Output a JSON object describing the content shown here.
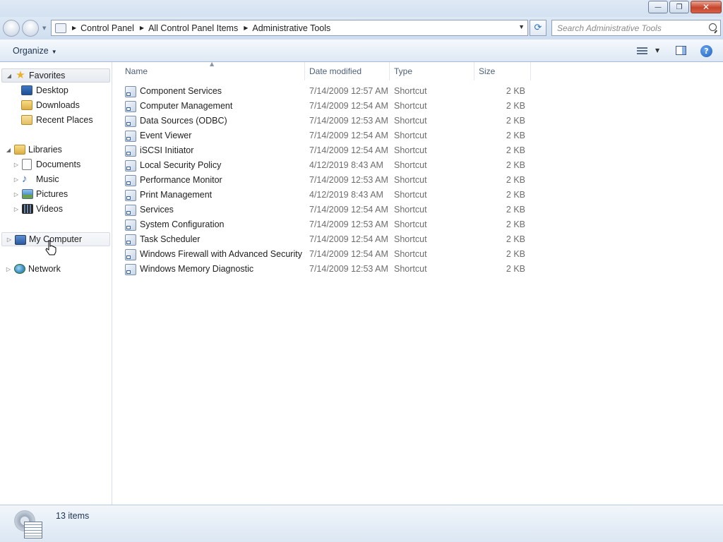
{
  "window": {
    "controls": {
      "minimize": "—",
      "restore": "❐",
      "close": "✕"
    }
  },
  "address_bar": {
    "crumbs": [
      "Control Panel",
      "All Control Panel Items",
      "Administrative Tools"
    ],
    "search_placeholder": "Search Administrative Tools"
  },
  "command_bar": {
    "organize_label": "Organize",
    "help_label": "?"
  },
  "nav_pane": {
    "favorites": {
      "label": "Favorites",
      "items": [
        "Desktop",
        "Downloads",
        "Recent Places"
      ]
    },
    "libraries": {
      "label": "Libraries",
      "items": [
        "Documents",
        "Music",
        "Pictures",
        "Videos"
      ]
    },
    "computer": {
      "label": "My Computer"
    },
    "network": {
      "label": "Network"
    }
  },
  "columns": {
    "name": "Name",
    "date": "Date modified",
    "type": "Type",
    "size": "Size"
  },
  "files": [
    {
      "name": "Component Services",
      "date": "7/14/2009 12:57 AM",
      "type": "Shortcut",
      "size": "2 KB"
    },
    {
      "name": "Computer Management",
      "date": "7/14/2009 12:54 AM",
      "type": "Shortcut",
      "size": "2 KB"
    },
    {
      "name": "Data Sources (ODBC)",
      "date": "7/14/2009 12:53 AM",
      "type": "Shortcut",
      "size": "2 KB"
    },
    {
      "name": "Event Viewer",
      "date": "7/14/2009 12:54 AM",
      "type": "Shortcut",
      "size": "2 KB"
    },
    {
      "name": "iSCSI Initiator",
      "date": "7/14/2009 12:54 AM",
      "type": "Shortcut",
      "size": "2 KB"
    },
    {
      "name": "Local Security Policy",
      "date": "4/12/2019 8:43 AM",
      "type": "Shortcut",
      "size": "2 KB"
    },
    {
      "name": "Performance Monitor",
      "date": "7/14/2009 12:53 AM",
      "type": "Shortcut",
      "size": "2 KB"
    },
    {
      "name": "Print Management",
      "date": "4/12/2019 8:43 AM",
      "type": "Shortcut",
      "size": "2 KB"
    },
    {
      "name": "Services",
      "date": "7/14/2009 12:54 AM",
      "type": "Shortcut",
      "size": "2 KB"
    },
    {
      "name": "System Configuration",
      "date": "7/14/2009 12:53 AM",
      "type": "Shortcut",
      "size": "2 KB"
    },
    {
      "name": "Task Scheduler",
      "date": "7/14/2009 12:54 AM",
      "type": "Shortcut",
      "size": "2 KB"
    },
    {
      "name": "Windows Firewall with Advanced Security",
      "date": "7/14/2009 12:54 AM",
      "type": "Shortcut",
      "size": "2 KB"
    },
    {
      "name": "Windows Memory Diagnostic",
      "date": "7/14/2009 12:53 AM",
      "type": "Shortcut",
      "size": "2 KB"
    }
  ],
  "status": {
    "item_count": "13 items"
  }
}
